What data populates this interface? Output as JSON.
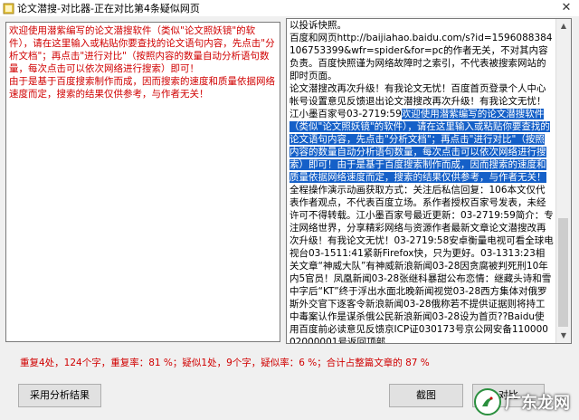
{
  "window": {
    "title": "论文潜搜-对比器-正在对比第4条疑似网页"
  },
  "left_pane": {
    "text": "欢迎使用潜紫编写的论文潜搜软件（类似\"论文照妖镜\"的软件），请在这里输入或粘贴你要查找的论文语句内容，先点击\"分析文档\"；再点击\"进行对比\"（按照内容的数量自动分析语句数量，每次点击可以依次网络进行搜索）即可！\n由于是基于百度搜索制作而成，因而搜索的速度和质量依据网络速度而定，搜索的结果仅供参考，与作者无关！"
  },
  "right_pane": {
    "text_before": "以投诉快照。\n百度和网页http://baijiahao.baidu.com/s?id=1596088384106753399&wfr=spider&for=pc的作者无关，不对其内容负责。百度快照谨为网络故障时之索引，不代表被搜索网站的即时页面。\n论文潜搜改再次升级！有我论文无忧！百度首页登录个人中心帐号设置意见反馈退出论文潜搜改再次升级！有我论文无忧！江小墨百家号03-2719:59",
    "highlight": "欢迎使用潜紫编写的论文潜搜软件（类似\"论文照妖镜\"的软件），请在这里输入或粘贴你要查找的论文语句内容，先点击\"分析文档\"；再点击\"进行对比\"（按照内容的数量自动分析语句数量，每次点击可以依次网络进行搜索）即可！由于是基于百度搜索制作而成，因而搜索的速度和质量依据网络速度而定，搜索的结果仅供参考，与作者无关！",
    "text_after": "全程操作演示动画获取方式：关注后私信回复：106本文仅代表作者观点，不代表百度立场。系作者授权百家号发表，未经许可不得转载。江小墨百家号最近更新：03-2719:59简介：专注网络世界，分享精彩网络与资源作者最新文章论文潜搜改再次升级！有我论文无忧！03-2719:58安卓衡量电视可看全球电视台03-1511:41紧新Firefox快，只为更好。03-1313:23相关文章“神威大队”有神威新浪新闻03-28因贪腐被判死刑10年内5官员！凤凰新闻03-28张继科暴甜公布恋情：继藏头诗和雪中字后“KT”终于浮出水面北晚新闻视觉03-28西方集体对俄罗斯外交官下逐客令新浪新闻03-28俄称若不提供证据则将持工中毒案认作是谋杀俄公民新浪新闻03-28设为首页??Baidu使用百度前必读意见反馈京ICP证030173号京公网安备11000002000001号返回顶部"
  },
  "summary": {
    "text": "重复4处，124个字，重复率：81 %；疑似1处，9个字，疑似率：6 %；合计占整篇文章的 87 %"
  },
  "buttons": {
    "use_analysis": "采用分析结果",
    "screenshot": "截图",
    "compare": "对比"
  },
  "watermark": {
    "text": "广东龙网"
  },
  "colors": {
    "accent_red": "#d00000",
    "highlight_bg": "#1560c8"
  }
}
